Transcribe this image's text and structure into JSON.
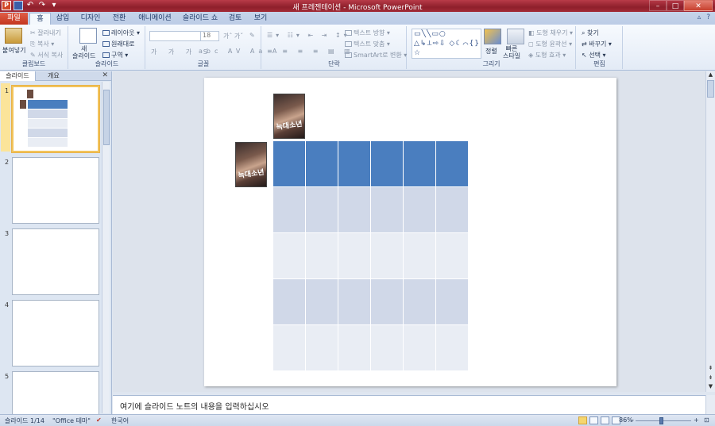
{
  "window": {
    "title": "새 프레젠테이션 - Microsoft PowerPoint"
  },
  "tabs": [
    {
      "label": "파일"
    },
    {
      "label": "홈"
    },
    {
      "label": "삽입"
    },
    {
      "label": "디자인"
    },
    {
      "label": "전환"
    },
    {
      "label": "애니메이션"
    },
    {
      "label": "슬라이드 쇼"
    },
    {
      "label": "검토"
    },
    {
      "label": "보기"
    }
  ],
  "ribbon": {
    "clipboard": {
      "paste": "붙여넣기",
      "cut": "잘라내기",
      "copy": "복사",
      "format_painter": "서식 복사",
      "label": "클립보드"
    },
    "slides": {
      "new_slide": "새\n슬라이드",
      "layout": "레이아웃",
      "reset": "원래대로",
      "section": "구역",
      "label": "슬라이드"
    },
    "font": {
      "size": "18",
      "label": "글꼴"
    },
    "paragraph": {
      "text_direction": "텍스트 방향",
      "align_text": "텍스트 맞춤",
      "smartart": "SmartArt로 변환",
      "label": "단락"
    },
    "drawing": {
      "arrange": "정렬",
      "quick_styles": "빠른\n스타일",
      "shape_fill": "도형 채우기",
      "shape_outline": "도형 윤곽선",
      "shape_effects": "도형 효과",
      "label": "그리기"
    },
    "editing": {
      "find": "찾기",
      "replace": "바꾸기",
      "select": "선택",
      "label": "편집"
    }
  },
  "pane": {
    "tab_slides": "슬라이드",
    "tab_outline": "개요",
    "thumbnails": [
      "1",
      "2",
      "3",
      "4",
      "5"
    ]
  },
  "slide": {
    "poster_text": "늑대소년"
  },
  "notes": {
    "placeholder": "여기에 슬라이드 노트의 내용을 입력하십시오"
  },
  "status": {
    "slide_counter": "슬라이드 1/14",
    "theme": "\"Office 테마\"",
    "language": "한국어",
    "zoom": "86%"
  }
}
